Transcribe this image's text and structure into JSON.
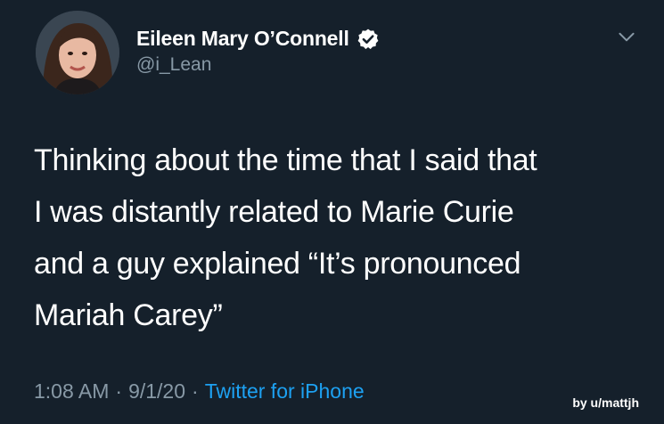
{
  "tweet": {
    "author_name": "Eileen Mary O’Connell",
    "handle": "@i_Lean",
    "text": "Thinking about the time that I said that\nI was distantly related to Marie Curie\nand a guy explained “It’s pronounced\nMariah Carey”",
    "time": "1:08 AM",
    "separator": "·",
    "date": "9/1/20",
    "source": "Twitter for iPhone"
  },
  "icons": {
    "verified": "verified-badge-icon",
    "menu": "chevron-down-icon"
  },
  "watermark": "by u/mattjh",
  "colors": {
    "background": "#15202b",
    "text": "#ffffff",
    "secondary": "#8899a6",
    "accent": "#1da1f2"
  }
}
